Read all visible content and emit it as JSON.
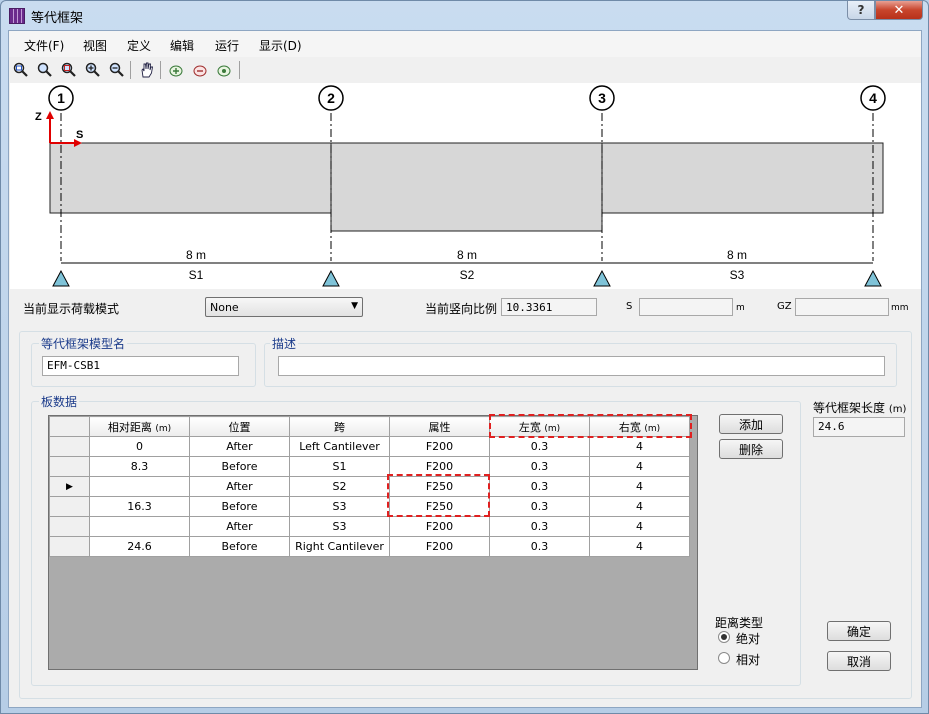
{
  "window": {
    "title": "等代框架",
    "help_label": "?",
    "close_label": "✕"
  },
  "menu": [
    {
      "label": "文件(F)"
    },
    {
      "label": "视图"
    },
    {
      "label": "定义"
    },
    {
      "label": "编辑"
    },
    {
      "label": "运行"
    },
    {
      "label": "显示(D)"
    }
  ],
  "toolbar": {
    "tools": [
      "zoom-window-icon",
      "zoom-realtime-icon",
      "zoom-fit-icon",
      "zoom-in-icon",
      "zoom-out-icon",
      "pan-hand-icon",
      "view-option-1-icon",
      "view-option-2-icon",
      "view-option-3-icon"
    ]
  },
  "diagram": {
    "axis_z": "Z",
    "axis_s": "S",
    "grid_labels": [
      "1",
      "2",
      "3",
      "4"
    ],
    "span_lengths": [
      "8 m",
      "8 m",
      "8 m"
    ],
    "span_names": [
      "S1",
      "S2",
      "S3"
    ]
  },
  "status": {
    "load_mode_label": "当前显示荷载模式",
    "load_mode_value": "None",
    "scale_label": "当前竖向比例",
    "scale_value": "10.3361",
    "s_label": "S",
    "s_value": "",
    "s_unit": "m",
    "gz_label": "GZ",
    "gz_value": "",
    "gz_unit": "mm"
  },
  "model": {
    "name_title": "等代框架模型名",
    "name_value": "EFM-CSB1",
    "desc_title": "描述",
    "desc_value": ""
  },
  "slab": {
    "group_title": "板数据",
    "columns": [
      {
        "label": "相对距离",
        "unit": "(m)"
      },
      {
        "label": "位置",
        "unit": ""
      },
      {
        "label": "跨",
        "unit": ""
      },
      {
        "label": "属性",
        "unit": ""
      },
      {
        "label": "左宽",
        "unit": "(m)"
      },
      {
        "label": "右宽",
        "unit": "(m)"
      }
    ],
    "rows": [
      {
        "marker": "",
        "dist": "0",
        "pos": "After",
        "span": "Left Cantilever",
        "prop": "F200",
        "left": "0.3",
        "right": "4"
      },
      {
        "marker": "",
        "dist": "8.3",
        "pos": "Before",
        "span": "S1",
        "prop": "F200",
        "left": "0.3",
        "right": "4"
      },
      {
        "marker": "▶",
        "dist": "",
        "pos": "After",
        "span": "S2",
        "prop": "F250",
        "left": "0.3",
        "right": "4"
      },
      {
        "marker": "",
        "dist": "16.3",
        "pos": "Before",
        "span": "S3",
        "prop": "F250",
        "left": "0.3",
        "right": "4"
      },
      {
        "marker": "",
        "dist": "",
        "pos": "After",
        "span": "S3",
        "prop": "F200",
        "left": "0.3",
        "right": "4"
      },
      {
        "marker": "",
        "dist": "24.6",
        "pos": "Before",
        "span": "Right Cantilever",
        "prop": "F200",
        "left": "0.3",
        "right": "4"
      }
    ],
    "add_label": "添加",
    "delete_label": "删除"
  },
  "length": {
    "title": "等代框架长度",
    "unit": "(m)",
    "value": "24.6"
  },
  "distance_type": {
    "title": "距离类型",
    "options": [
      {
        "label": "绝对",
        "selected": true
      },
      {
        "label": "相对",
        "selected": false
      }
    ]
  },
  "buttons": {
    "ok_label": "确定",
    "cancel_label": "取消"
  },
  "colors": {
    "highlight_dash": "#e02020",
    "axis_arrow": "#e00000",
    "support": "#7fc3d8",
    "slab_fill": "#d7d7d7"
  }
}
